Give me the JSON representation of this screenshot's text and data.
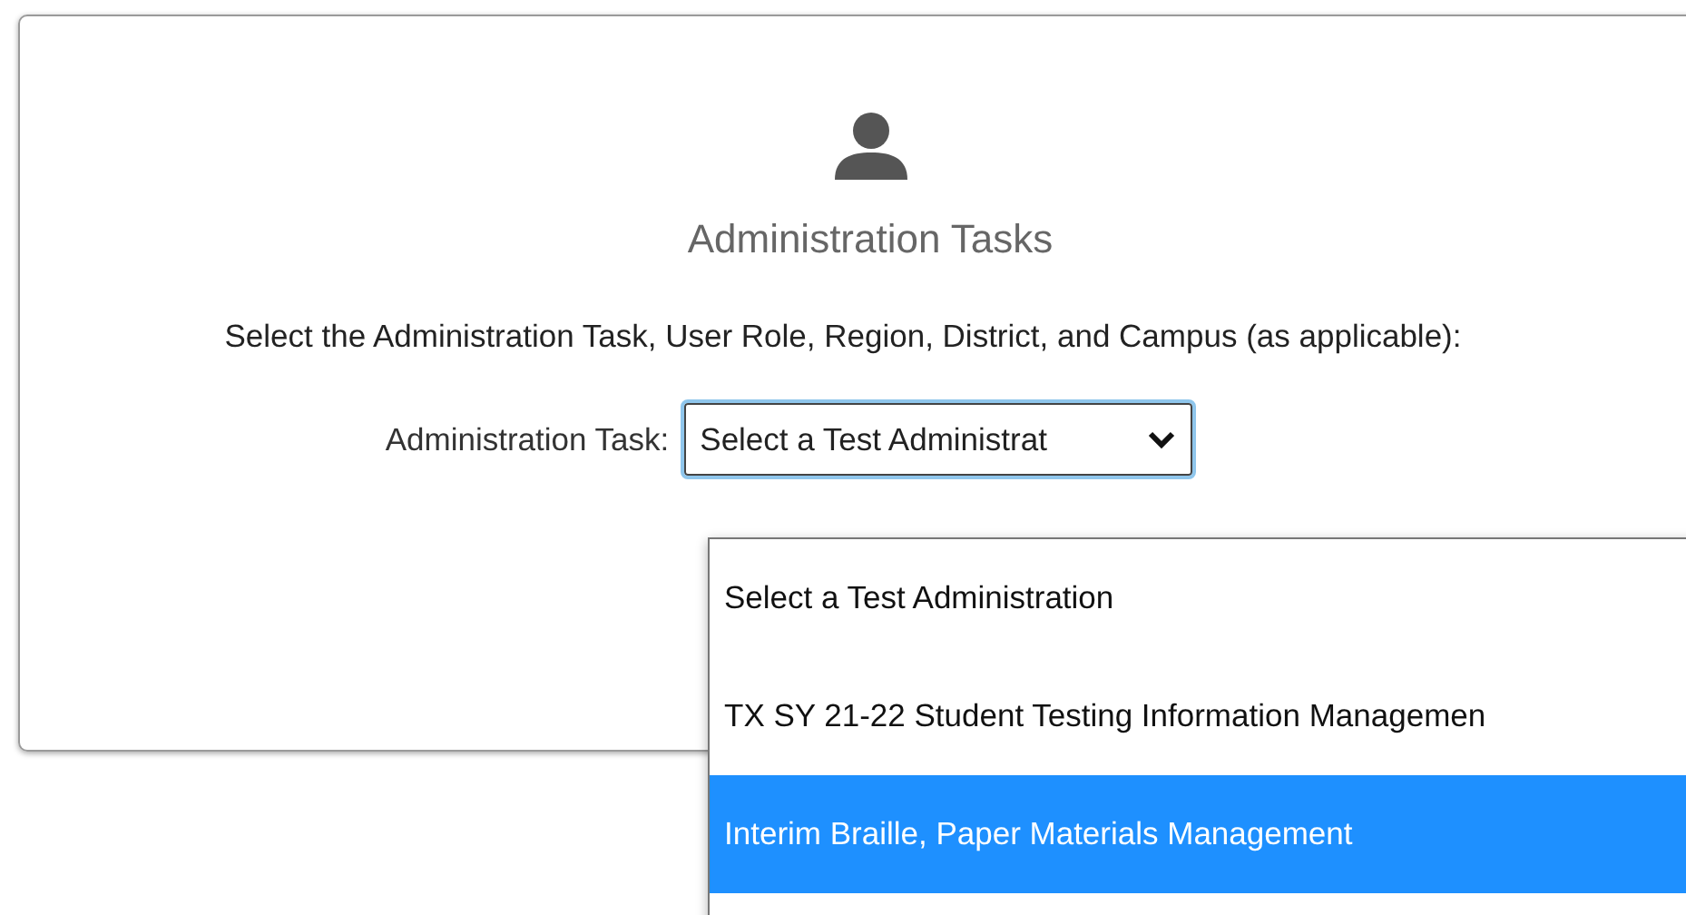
{
  "panel": {
    "title": "Administration Tasks",
    "instruction": "Select the Administration Task, User Role, Region, District, and Campus (as applicable):"
  },
  "task_field": {
    "label": "Administration Task:",
    "value": "Select a Test Administrat",
    "expanded": true
  },
  "options": [
    {
      "label": "Select a Test Administration",
      "selected": false
    },
    {
      "label": "TX SY 21-22 Student Testing Information Managemen",
      "selected": false
    },
    {
      "label": "Interim Braille, Paper Materials Management",
      "selected": true
    }
  ]
}
